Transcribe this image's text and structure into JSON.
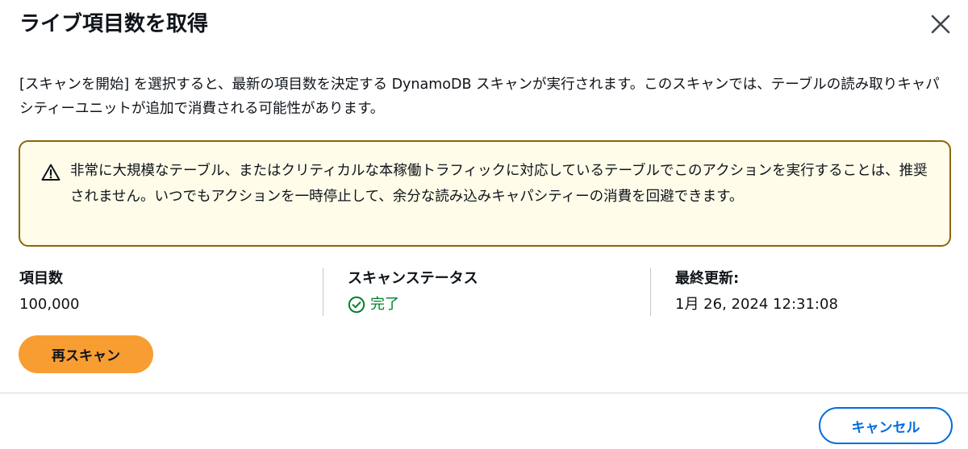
{
  "modal": {
    "title": "ライブ項目数を取得",
    "close_icon": "close-icon"
  },
  "description": "[スキャンを開始] を選択すると、最新の項目数を決定する DynamoDB スキャンが実行されます。このスキャンでは、テーブルの読み取りキャパシティーユニットが追加で消費される可能性があります。",
  "warning": {
    "icon": "warning-icon",
    "text": "非常に大規模なテーブル、またはクリティカルな本稼働トラフィックに対応しているテーブルでこのアクションを実行することは、推奨されません。いつでもアクションを一時停止して、余分な読み込みキャパシティーの消費を回避できます。",
    "colors": {
      "background": "#fffce9",
      "border": "#8d6605"
    }
  },
  "stats": {
    "item_count": {
      "label": "項目数",
      "value": "100,000"
    },
    "scan_status": {
      "label": "スキャンステータス",
      "value": "完了",
      "icon": "check-circle-icon",
      "color": "#00802f"
    },
    "last_updated": {
      "label": "最終更新:",
      "value": "1月 26, 2024 12:31:08"
    }
  },
  "actions": {
    "rescan_label": "再スキャン",
    "cancel_label": "キャンセル",
    "colors": {
      "primary": "#f89d32",
      "link": "#006ce0"
    }
  }
}
